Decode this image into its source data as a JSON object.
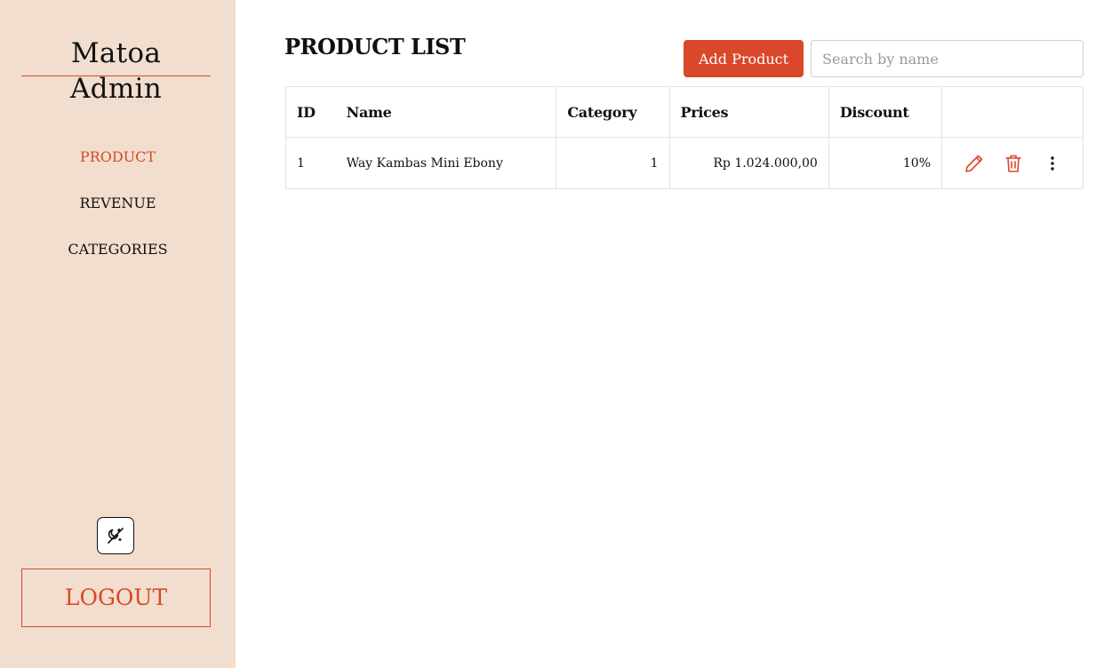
{
  "sidebar": {
    "brand": "Matoa Admin",
    "items": [
      {
        "label": "PRODUCT",
        "active": true
      },
      {
        "label": "REVENUE",
        "active": false
      },
      {
        "label": "CATEGORIES",
        "active": false
      }
    ],
    "theme_toggle_icon": "dark-mode-toggle-icon",
    "logout_label": "LOGOUT"
  },
  "main": {
    "title": "PRODUCT LIST",
    "add_button_label": "Add Product",
    "search": {
      "placeholder": "Search by name",
      "value": ""
    },
    "table": {
      "headers": [
        "ID",
        "Name",
        "Category",
        "Prices",
        "Discount",
        ""
      ],
      "rows": [
        {
          "id": "1",
          "name": "Way Kambas Mini Ebony",
          "category": "1",
          "price": "Rp 1.024.000,00",
          "discount": "10%"
        }
      ],
      "row_actions": [
        "edit-icon",
        "delete-icon",
        "more-vertical-icon"
      ]
    }
  },
  "colors": {
    "accent": "#d9482a",
    "sidebar_bg": "#f2dece",
    "text": "#111111",
    "border": "#e4e4e4"
  }
}
